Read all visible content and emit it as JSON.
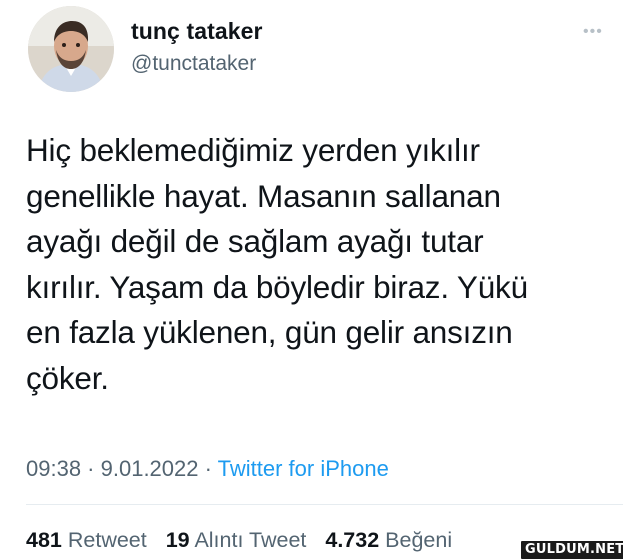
{
  "author": {
    "name": "tunç tataker",
    "handle": "@tunctataker",
    "avatar_icon": "profile-photo"
  },
  "more_icon": "more-options-icon",
  "tweet_text": "Hiç beklemediğimiz yerden yıkılır\ngenellikle hayat. Masanın sallanan\nayağı değil de sağlam ayağı tutar\nkırılır. Yaşam da böyledir biraz. Yükü\nen fazla yüklenen, gün gelir ansızın\nçöker.",
  "meta": {
    "time": "09:38",
    "separator": " · ",
    "date": "9.01.2022",
    "separator2": " · ",
    "source": "Twitter for iPhone"
  },
  "stats": {
    "retweets_count": "481",
    "retweets_label": "Retweet",
    "quotes_count": "19",
    "quotes_label": "Alıntı Tweet",
    "likes_count": "4.732",
    "likes_label": "Beğeni"
  },
  "watermark": "GULDUM.NET",
  "colors": {
    "text": "#0f1419",
    "secondary": "#536471",
    "link": "#1d9bf0"
  }
}
